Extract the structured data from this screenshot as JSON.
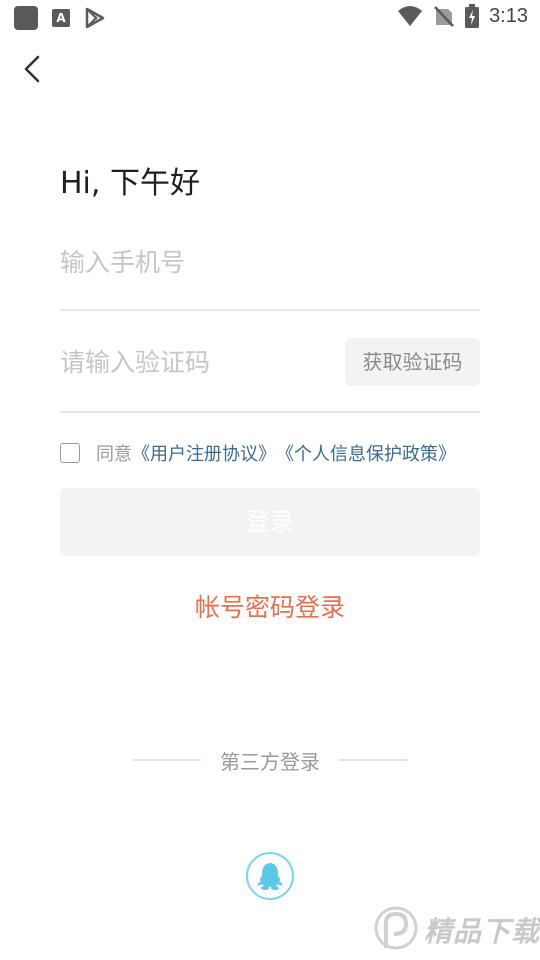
{
  "status_bar": {
    "time": "3:13"
  },
  "greeting": "Hi, 下午好",
  "phone": {
    "placeholder": "输入手机号",
    "value": ""
  },
  "code": {
    "placeholder": "请输入验证码",
    "value": "",
    "button_label": "获取验证码"
  },
  "agreement": {
    "prefix": "同意",
    "user_agreement": "《用户注册协议》",
    "privacy_policy": "《个人信息保护政策》"
  },
  "login_button": "登录",
  "password_login": "帐号密码登录",
  "third_party_label": "第三方登录",
  "watermark": "精品下载",
  "colors": {
    "accent": "#e5704f",
    "link": "#3b6b8f",
    "qq_ring": "#7dd4ec",
    "qq_icon": "#5bc8e8"
  },
  "icons": {
    "back": "chevron-left-icon",
    "qq": "qq-penguin-icon",
    "wifi": "wifi-icon",
    "signal": "no-signal-icon",
    "battery": "battery-charging-icon"
  }
}
